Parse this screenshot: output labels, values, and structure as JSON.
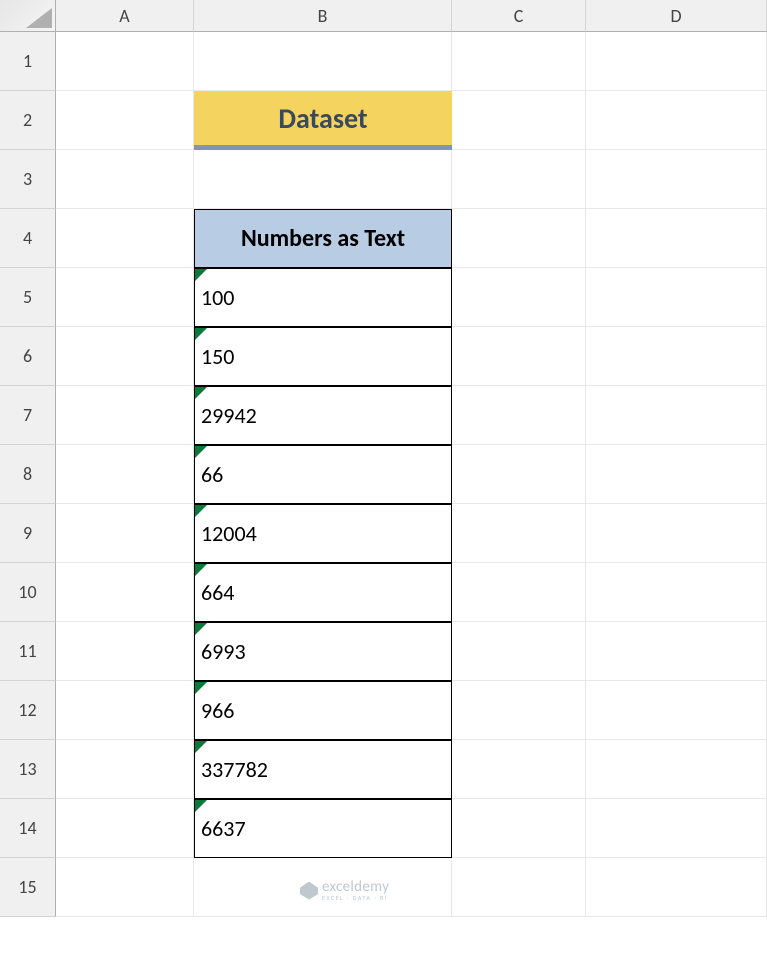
{
  "columns": [
    "A",
    "B",
    "C",
    "D"
  ],
  "rows": [
    "1",
    "2",
    "3",
    "4",
    "5",
    "6",
    "7",
    "8",
    "9",
    "10",
    "11",
    "12",
    "13",
    "14",
    "15"
  ],
  "title": "Dataset",
  "table_header": "Numbers as Text",
  "data_values": [
    "100",
    "150",
    "29942",
    "66",
    "12004",
    "664",
    "6993",
    "966",
    "337782",
    "6637"
  ],
  "watermark": {
    "main": "exceldemy",
    "sub": "EXCEL · DATA · BI"
  },
  "chart_data": {
    "type": "table",
    "title": "Dataset",
    "columns": [
      "Numbers as Text"
    ],
    "rows": [
      [
        "100"
      ],
      [
        "150"
      ],
      [
        "29942"
      ],
      [
        "66"
      ],
      [
        "12004"
      ],
      [
        "664"
      ],
      [
        "6993"
      ],
      [
        "966"
      ],
      [
        "337782"
      ],
      [
        "6637"
      ]
    ]
  }
}
